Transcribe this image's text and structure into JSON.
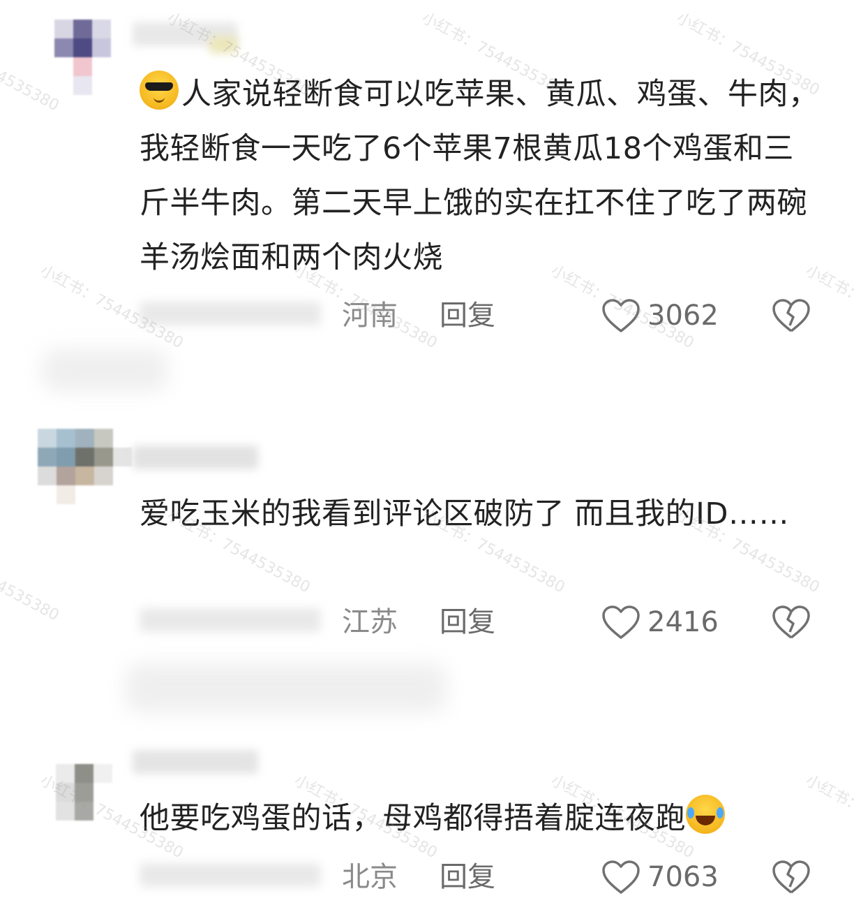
{
  "comments": [
    {
      "text": "人家说轻断食可以吃苹果、黄瓜、鸡蛋、牛肉，我轻断食一天吃了6个苹果7根黄瓜18个鸡蛋和三斤半牛肉。第二天早上饿的实在扛不住了吃了两碗羊汤烩面和两个肉火烧",
      "leading_emoji": "sunglasses-tears-emoji",
      "location": "河南",
      "reply_label": "回复",
      "likes": "3062"
    },
    {
      "text": "爱吃玉米的我看到评论区破防了 而且我的ID……",
      "location": "江苏",
      "reply_label": "回复",
      "likes": "2416"
    },
    {
      "text": "他要吃鸡蛋的话，母鸡都得捂着腚连夜跑",
      "trailing_emoji": "rolling-laughing-emoji",
      "location": "北京",
      "reply_label": "回复",
      "likes": "7063"
    }
  ],
  "watermark": "小红书：7544535380",
  "colors": {
    "text": "#222222",
    "meta": "#8a8a8a",
    "icon": "#707070",
    "background": "#ffffff"
  }
}
